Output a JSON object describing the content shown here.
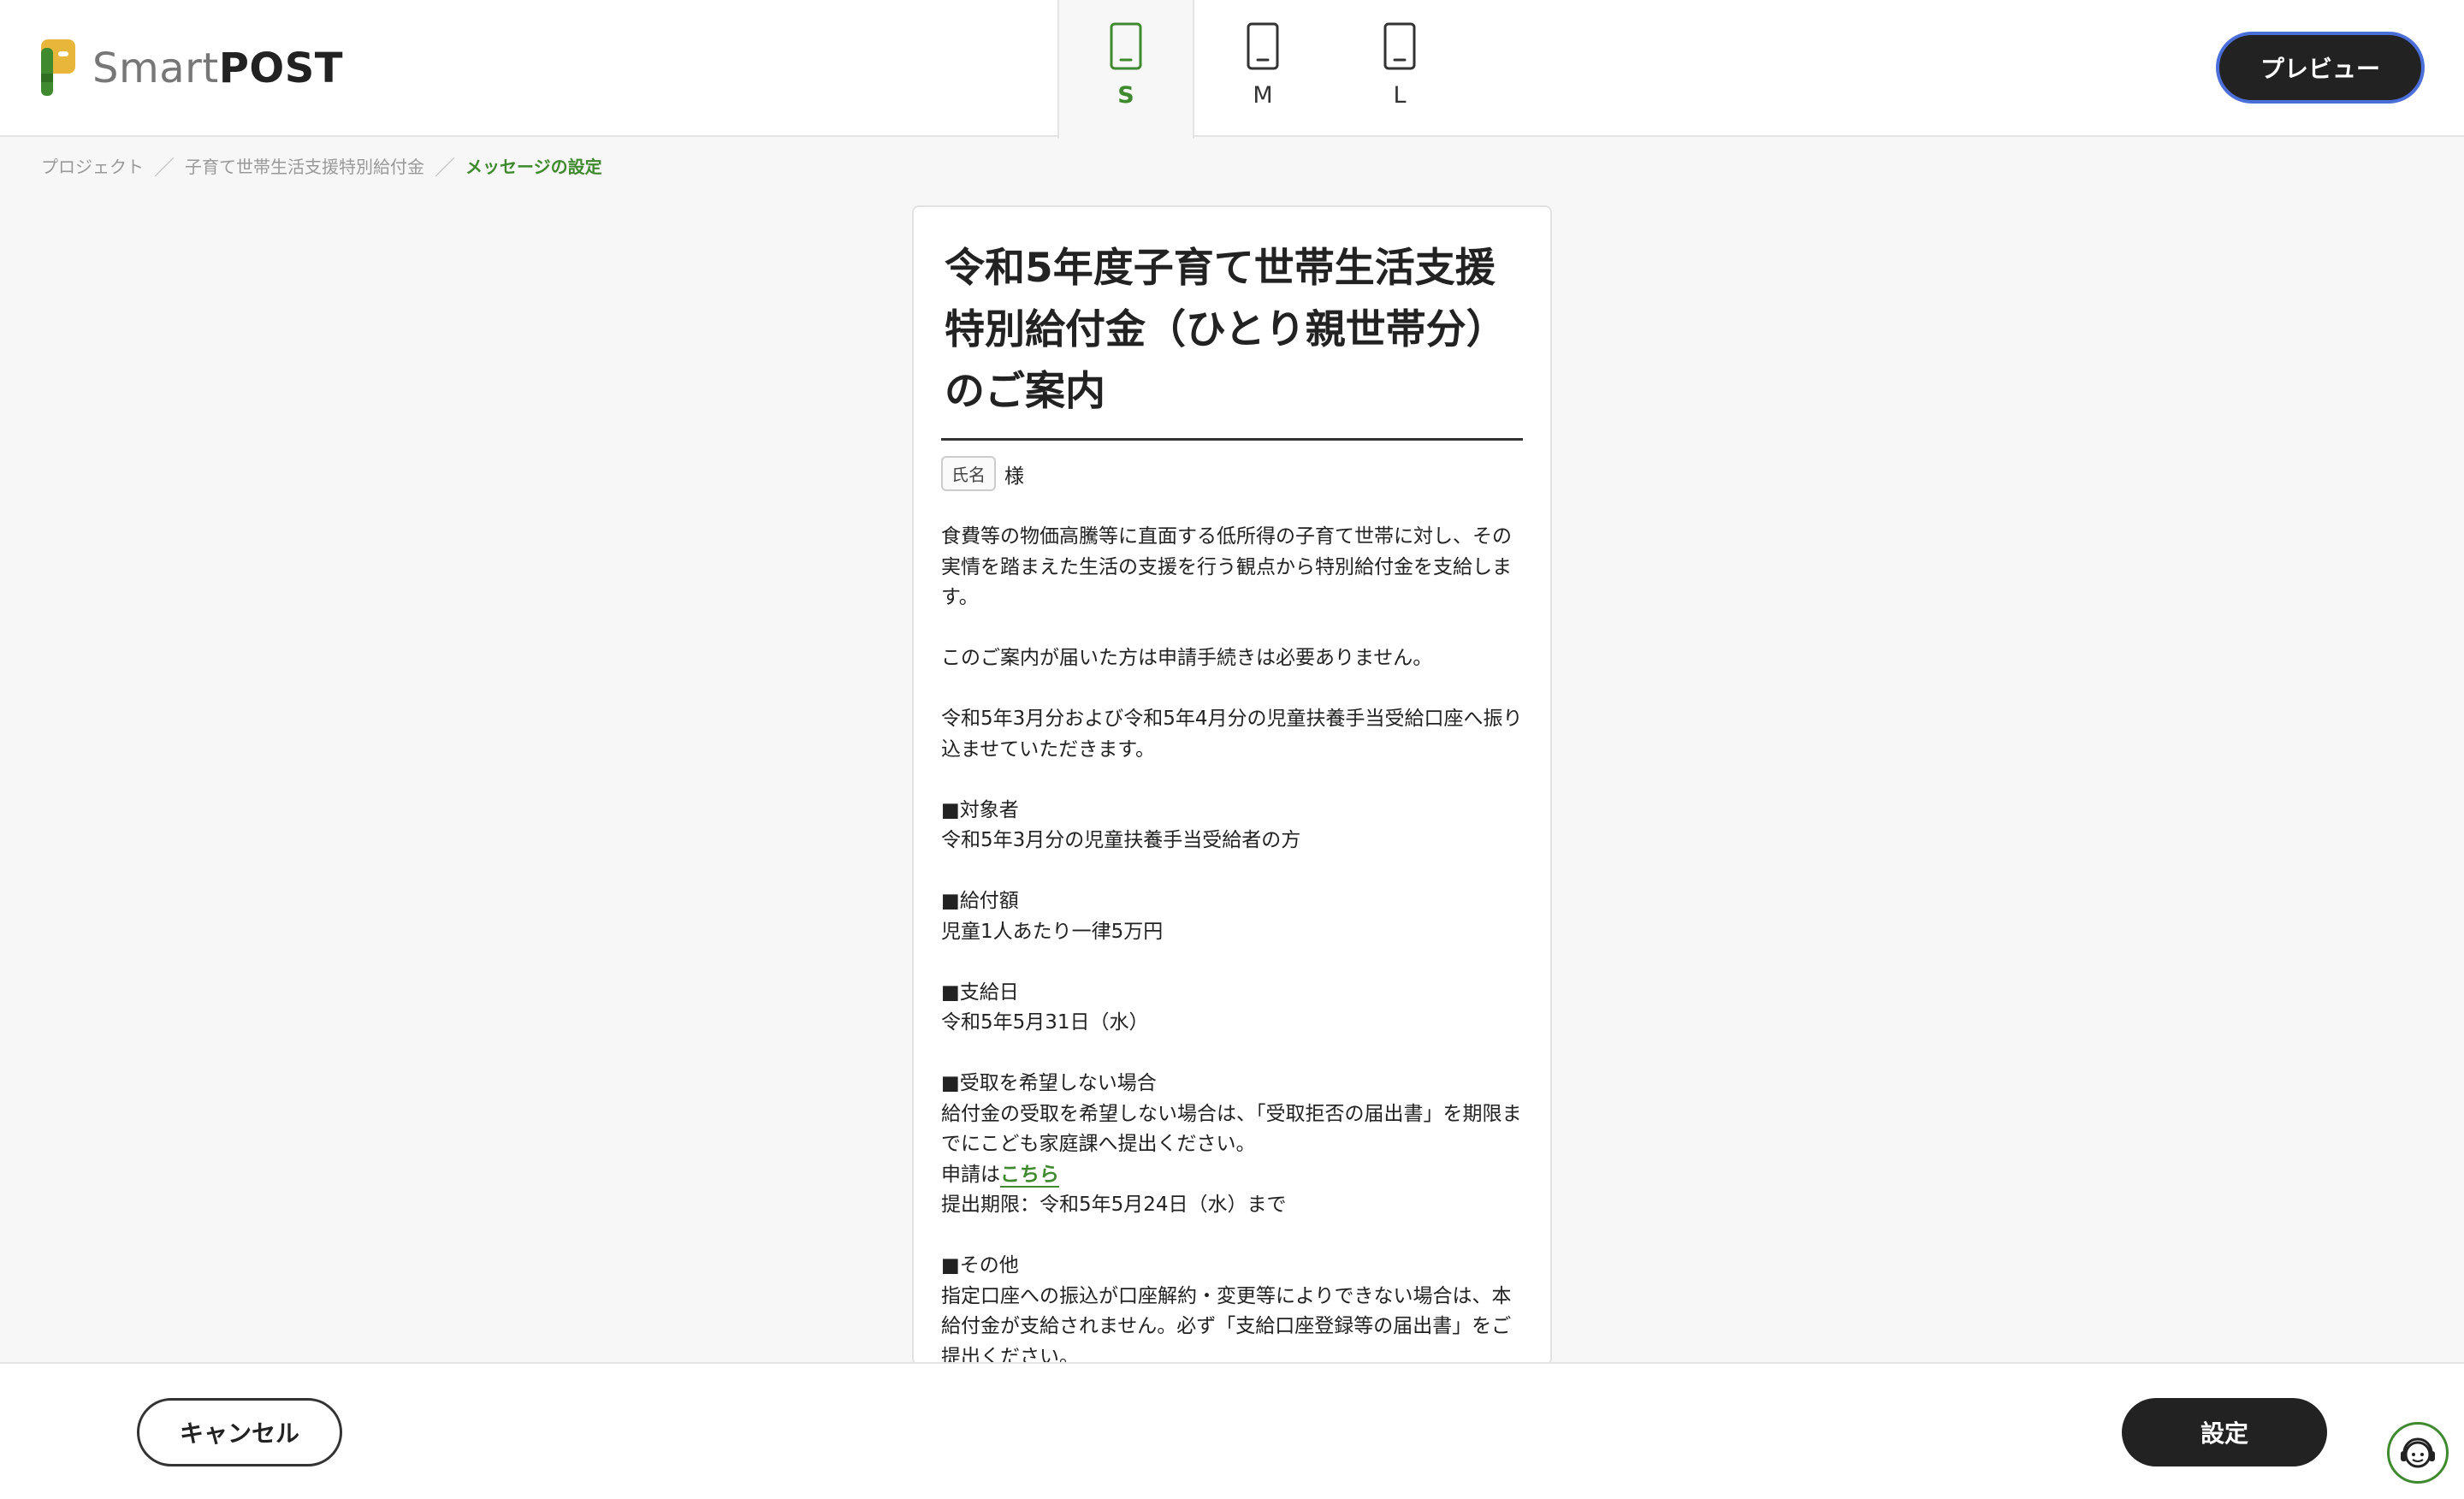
{
  "brand": {
    "name_light": "Smart",
    "name_bold": "POST"
  },
  "device_tabs": [
    {
      "label": "S",
      "active": true
    },
    {
      "label": "M",
      "active": false
    },
    {
      "label": "L",
      "active": false
    }
  ],
  "header": {
    "preview_label": "プレビュー"
  },
  "breadcrumb": {
    "items": [
      "プロジェクト",
      "子育て世帯生活支援特別給付金"
    ],
    "current": "メッセージの設定",
    "separator": "／"
  },
  "message": {
    "title": "令和5年度子育て世帯生活支援特別給付金（ひとり親世帯分）のご案内",
    "name_tag": "氏名",
    "honorific": "様",
    "paragraphs": [
      "食費等の物価高騰等に直面する低所得の子育て世帯に対し、その実情を踏まえた生活の支援を行う観点から特別給付金を支給します。",
      "このご案内が届いた方は申請手続きは必要ありません。",
      "令和5年3月分および令和5年4月分の児童扶養手当受給口座へ振り込ませていただきます。"
    ],
    "sections": {
      "target": {
        "heading": "■対象者",
        "text": "令和5年3月分の児童扶養手当受給者の方"
      },
      "amount": {
        "heading": "■給付額",
        "text": "児童1人あたり一律5万円"
      },
      "payday": {
        "heading": "■支給日",
        "text": "令和5年5月31日（水）"
      },
      "decline": {
        "heading": "■受取を希望しない場合",
        "text": "給付金の受取を希望しない場合は、「受取拒否の届出書」を期限までにこども家庭課へ提出ください。",
        "apply_prefix": "申請は",
        "apply_link": "こちら",
        "deadline": "提出期限：令和5年5月24日（水）まで"
      },
      "other": {
        "heading": "■その他",
        "text": "指定口座への振込が口座解約・変更等によりできない場合は、本給付金が支給されません。必ず「支給口座登録等の届出書」をご提出ください。"
      }
    }
  },
  "footer": {
    "cancel_label": "キャンセル",
    "submit_label": "設定"
  },
  "colors": {
    "accent": "#3f8a2e",
    "primary_button": "#222222",
    "focus_ring": "#4a6fd8"
  }
}
